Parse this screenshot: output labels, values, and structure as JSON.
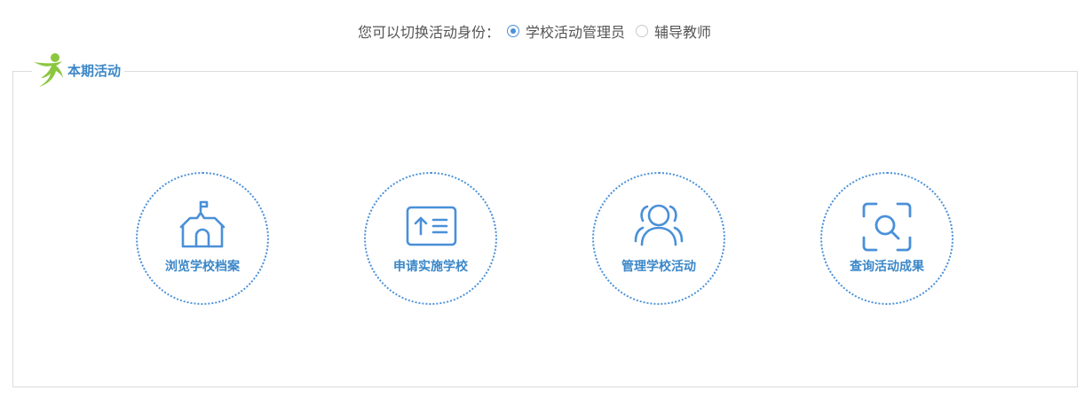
{
  "role_switch": {
    "prompt": "您可以切换活动身份：",
    "options": [
      {
        "label": "学校活动管理员",
        "selected": true
      },
      {
        "label": "辅导教师",
        "selected": false
      }
    ]
  },
  "panel": {
    "title": "本期活动",
    "logo_icon": "running-figure-icon"
  },
  "actions": [
    {
      "label": "浏览学校档案",
      "icon": "school-building-icon"
    },
    {
      "label": "申请实施学校",
      "icon": "upload-list-icon"
    },
    {
      "label": "管理学校活动",
      "icon": "user-group-icon"
    },
    {
      "label": "查询活动成果",
      "icon": "scan-search-icon"
    }
  ],
  "colors": {
    "accent": "#4a90d9",
    "title_blue": "#3b87c8",
    "logo_green": "#8cc63f",
    "text": "#555555",
    "border": "#dcdcdc"
  }
}
